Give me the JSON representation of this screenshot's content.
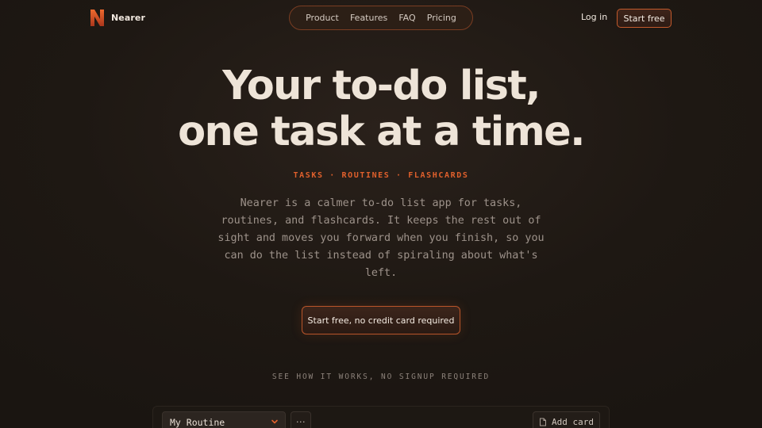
{
  "brand": {
    "name": "Nearer",
    "logo_letter": "N",
    "logo_icon": "nearer-logo-icon"
  },
  "nav": {
    "links": [
      "Product",
      "Features",
      "FAQ",
      "Pricing"
    ],
    "login_label": "Log in",
    "start_free_label": "Start free"
  },
  "hero": {
    "title_line1": "Your to-do list,",
    "title_line2": "one task at a time.",
    "tagline": "TASKS · ROUTINES · FLASHCARDS",
    "description": "Nearer is a calmer to-do list app for tasks, routines, and flashcards. It keeps the rest out of sight and moves you forward when you finish, so you can do the list instead of spiraling about what's left.",
    "cta_label": "Start free, no credit card required"
  },
  "demo": {
    "intro": "SEE HOW IT WORKS, NO SIGNUP REQUIRED",
    "routine_select_value": "My Routine",
    "more_label": "···",
    "add_card_label": "Add card",
    "icons": {
      "select": "chevron-down-icon",
      "more": "more-icon",
      "add_card": "add-card-icon"
    }
  },
  "colors": {
    "background": "#1e1813",
    "accent": "#e0602c",
    "accent_border": "#c45a2c",
    "heading": "#eee4d8",
    "body_text": "#9d928a"
  }
}
